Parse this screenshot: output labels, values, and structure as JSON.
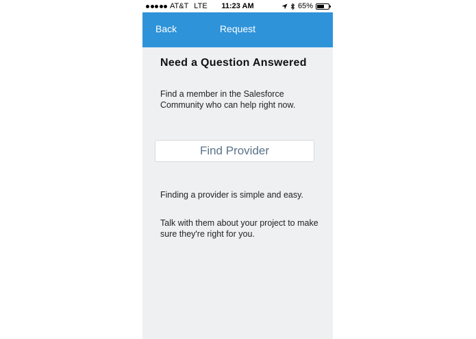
{
  "status_bar": {
    "carrier": "AT&T",
    "network": "LTE",
    "time": "11:23 AM",
    "battery_percent_label": "65%",
    "battery_level": 0.65,
    "signal_dots": 5,
    "location_icon": "location-arrow-icon",
    "bluetooth_icon": "bluetooth-icon"
  },
  "nav": {
    "back_label": "Back",
    "title": "Request",
    "color": "#2e93d9"
  },
  "content": {
    "heading": "Need a Question Answered",
    "subtext": "Find a member in the Salesforce Community who can help right now.",
    "find_button_label": "Find Provider",
    "info_1": "Finding a provider is simple and easy.",
    "info_2": "Talk with them about your project to make sure they're right for you."
  }
}
